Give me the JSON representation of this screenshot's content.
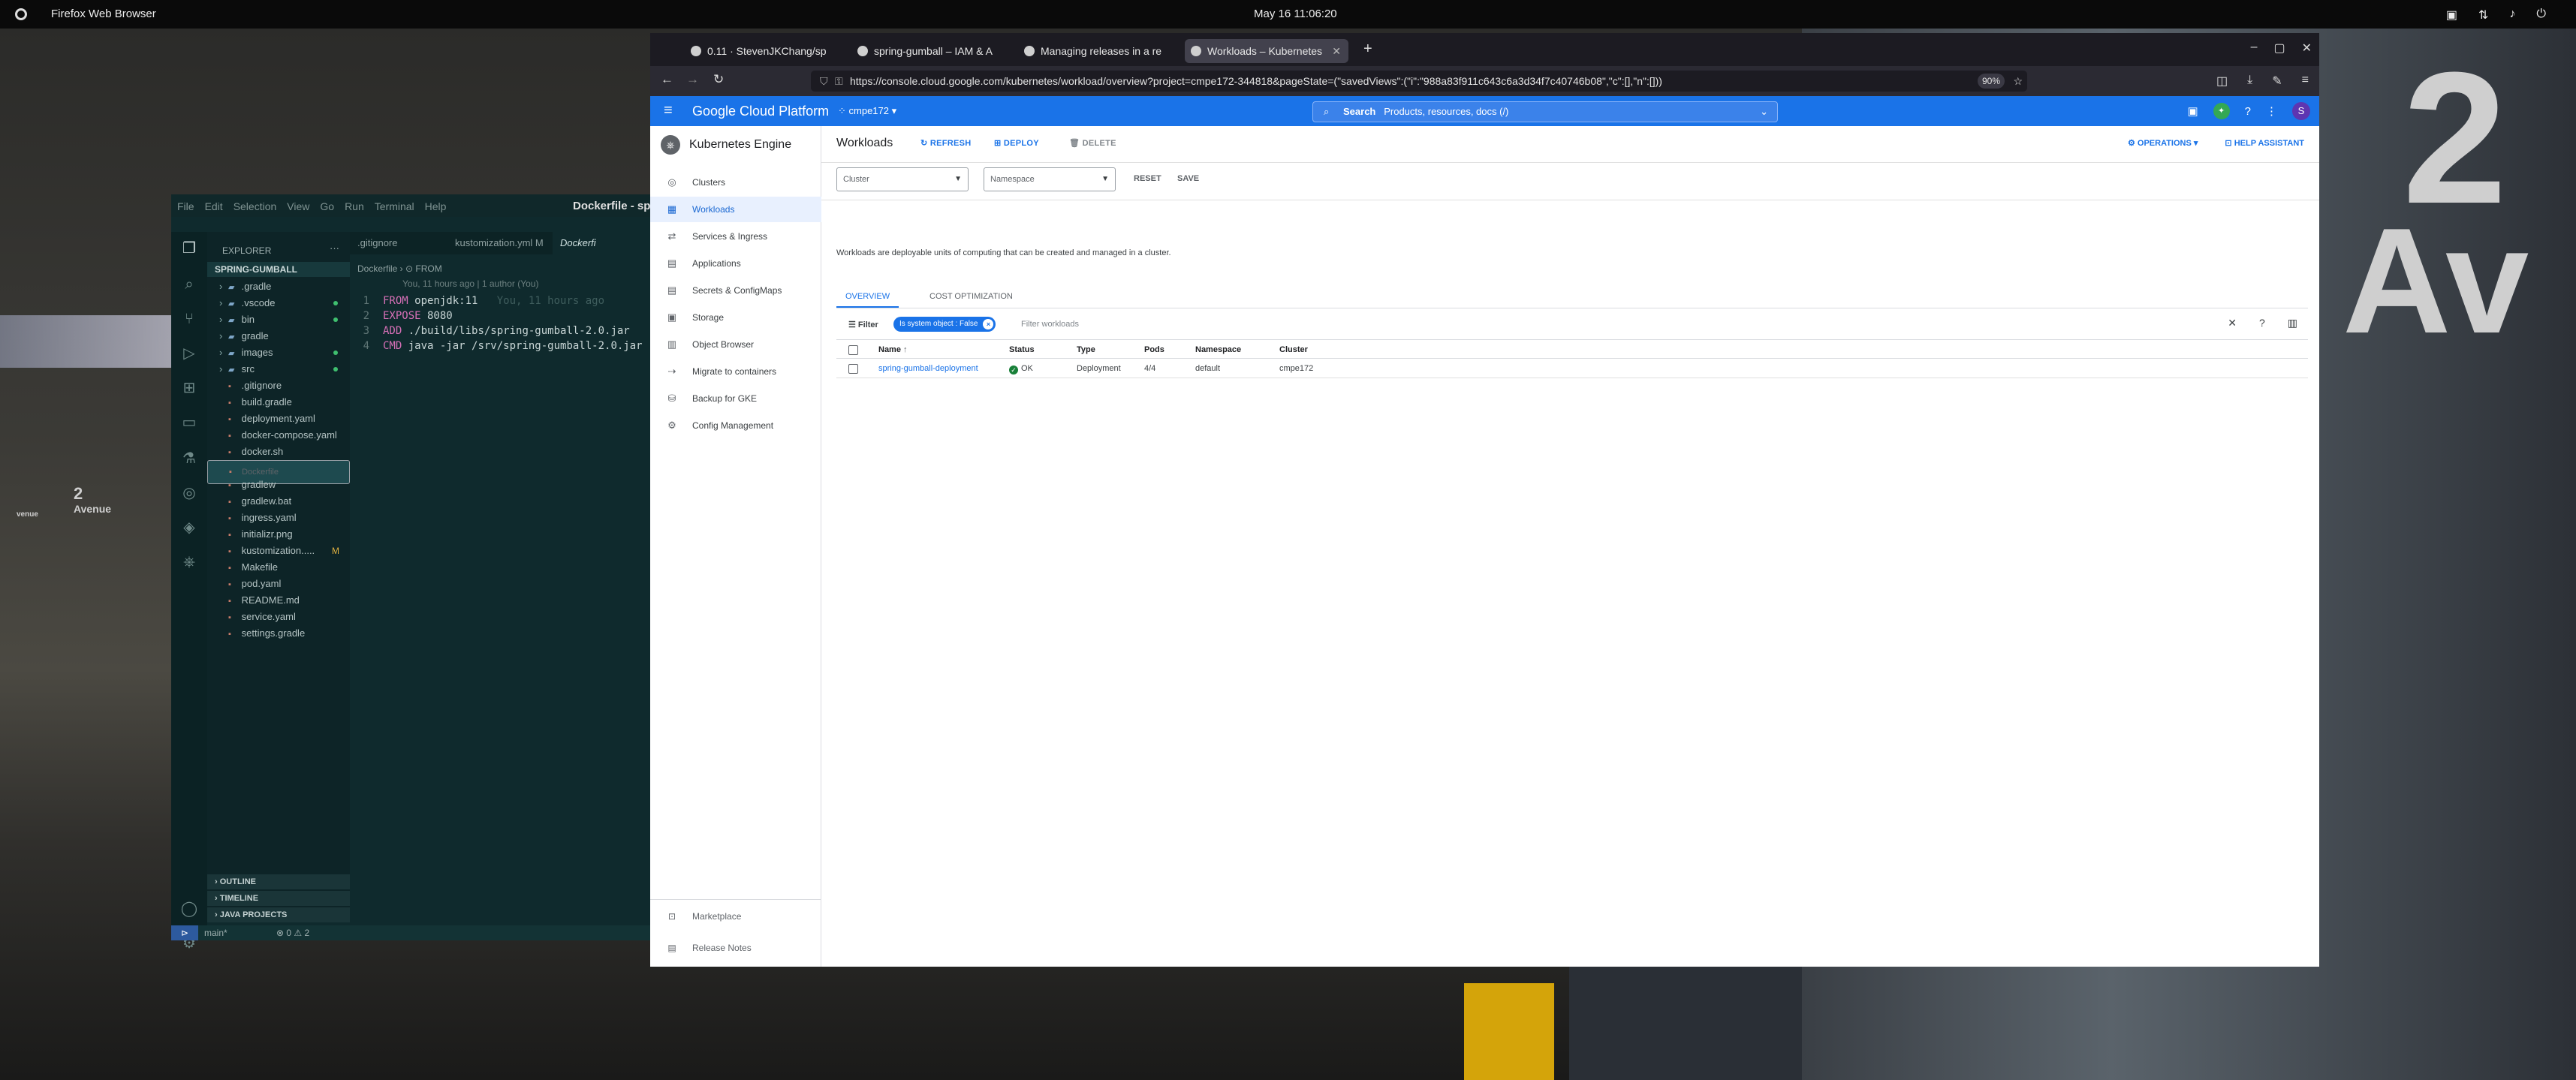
{
  "os": {
    "app_name": "Firefox Web Browser",
    "clock": "May 16  11:06:20"
  },
  "desktop": {
    "sign_big": "2",
    "sign_ave": "Av",
    "sign_small_num": "2",
    "sign_small_txt": "Avenue",
    "sign_left_txt": "venue"
  },
  "vscode": {
    "menu": [
      "File",
      "Edit",
      "Selection",
      "View",
      "Go",
      "Run",
      "Terminal",
      "Help"
    ],
    "title": "Dockerfile - sp",
    "explorer_label": "EXPLORER",
    "project": "SPRING-GUMBALL",
    "tree": [
      {
        "name": ".gradle",
        "type": "folder",
        "dot": false,
        "mark": ""
      },
      {
        "name": ".vscode",
        "type": "folder",
        "dot": true,
        "mark": ""
      },
      {
        "name": "bin",
        "type": "folder",
        "dot": true,
        "mark": ""
      },
      {
        "name": "gradle",
        "type": "folder",
        "dot": false,
        "mark": ""
      },
      {
        "name": "images",
        "type": "folder",
        "dot": true,
        "mark": ""
      },
      {
        "name": "src",
        "type": "folder",
        "dot": true,
        "mark": ""
      },
      {
        "name": ".gitignore",
        "type": "file",
        "dot": false,
        "mark": ""
      },
      {
        "name": "build.gradle",
        "type": "file",
        "dot": false,
        "mark": ""
      },
      {
        "name": "deployment.yaml",
        "type": "file",
        "dot": false,
        "mark": ""
      },
      {
        "name": "docker-compose.yaml",
        "type": "file",
        "dot": false,
        "mark": ""
      },
      {
        "name": "docker.sh",
        "type": "file",
        "dot": false,
        "mark": ""
      },
      {
        "name": "Dockerfile",
        "type": "file",
        "dot": false,
        "mark": "",
        "selected": true
      },
      {
        "name": "gradlew",
        "type": "file",
        "dot": false,
        "mark": ""
      },
      {
        "name": "gradlew.bat",
        "type": "file",
        "dot": false,
        "mark": ""
      },
      {
        "name": "ingress.yaml",
        "type": "file",
        "dot": false,
        "mark": ""
      },
      {
        "name": "initializr.png",
        "type": "file",
        "dot": false,
        "mark": ""
      },
      {
        "name": "kustomization.....",
        "type": "file",
        "dot": false,
        "mark": "M"
      },
      {
        "name": "Makefile",
        "type": "file",
        "dot": false,
        "mark": ""
      },
      {
        "name": "pod.yaml",
        "type": "file",
        "dot": false,
        "mark": ""
      },
      {
        "name": "README.md",
        "type": "file",
        "dot": false,
        "mark": ""
      },
      {
        "name": "service.yaml",
        "type": "file",
        "dot": false,
        "mark": ""
      },
      {
        "name": "settings.gradle",
        "type": "file",
        "dot": false,
        "mark": ""
      }
    ],
    "tabs": [
      ".gitignore",
      "kustomization.yml  M",
      "Dockerfi"
    ],
    "breadcrumb": "Dockerfile  ›  ⊙ FROM",
    "blame": "You, 11 hours ago | 1 author (You)",
    "code": [
      {
        "num": "1",
        "kw": "FROM",
        "rest": " openjdk:11",
        "ghost": "   You, 11 hours ago"
      },
      {
        "num": "2",
        "kw": "EXPOSE",
        "rest": " 8080",
        "ghost": ""
      },
      {
        "num": "3",
        "kw": "ADD",
        "rest": " ./build/libs/spring-gumball-2.0.jar",
        "ghost": ""
      },
      {
        "num": "4",
        "kw": "CMD",
        "rest": " java -jar /srv/spring-gumball-2.0.jar",
        "ghost": ""
      }
    ],
    "sections": [
      "OUTLINE",
      "TIMELINE",
      "JAVA PROJECTS"
    ],
    "status_branch": "main*",
    "status_problems": "⊗ 0 ⚠ 2"
  },
  "browser": {
    "tabs": [
      {
        "title": "0.11 · StevenJKChang/sp",
        "active": false
      },
      {
        "title": "spring-gumball – IAM & A",
        "active": false
      },
      {
        "title": "Managing releases in a re",
        "active": false
      },
      {
        "title": "Workloads – Kubernetes",
        "active": true
      }
    ],
    "url": "https://console.cloud.google.com/kubernetes/workload/overview?project=cmpe172-344818&pageState=(\"savedViews\":(\"i\":\"988a83f911c643c6a3d34f7c40746b08\",\"c\":[],\"n\":[]))",
    "zoom": "90%"
  },
  "gcp": {
    "brand": "Google Cloud Platform",
    "project": "cmpe172",
    "search_label": "Search",
    "search_hint": "Products, resources, docs (/)",
    "avatar_letter": "S",
    "product": "Kubernetes Engine",
    "nav": [
      "Clusters",
      "Workloads",
      "Services & Ingress",
      "Applications",
      "Secrets & ConfigMaps",
      "Storage",
      "Object Browser",
      "Migrate to containers",
      "Backup for GKE",
      "Config Management"
    ],
    "nav_active": "Workloads",
    "nav_bottom": [
      "Marketplace",
      "Release Notes"
    ],
    "page_title": "Workloads",
    "actions": {
      "refresh": "REFRESH",
      "deploy": "DEPLOY",
      "delete": "DELETE"
    },
    "right_links": {
      "operations": "OPERATIONS",
      "help": "HELP ASSISTANT"
    },
    "filters": {
      "cluster": "Cluster",
      "namespace": "Namespace",
      "reset": "RESET",
      "save": "SAVE"
    },
    "description": "Workloads are deployable units of computing that can be created and managed in a cluster.",
    "tabs": [
      "OVERVIEW",
      "COST OPTIMIZATION"
    ],
    "filter_label": "Filter",
    "chip": "Is system object : False",
    "filter_placeholder": "Filter workloads",
    "columns": [
      "Name",
      "Status",
      "Type",
      "Pods",
      "Namespace",
      "Cluster"
    ],
    "rows": [
      {
        "name": "spring-gumball-deployment",
        "status": "OK",
        "type": "Deployment",
        "pods": "4/4",
        "namespace": "default",
        "cluster": "cmpe172"
      }
    ]
  }
}
